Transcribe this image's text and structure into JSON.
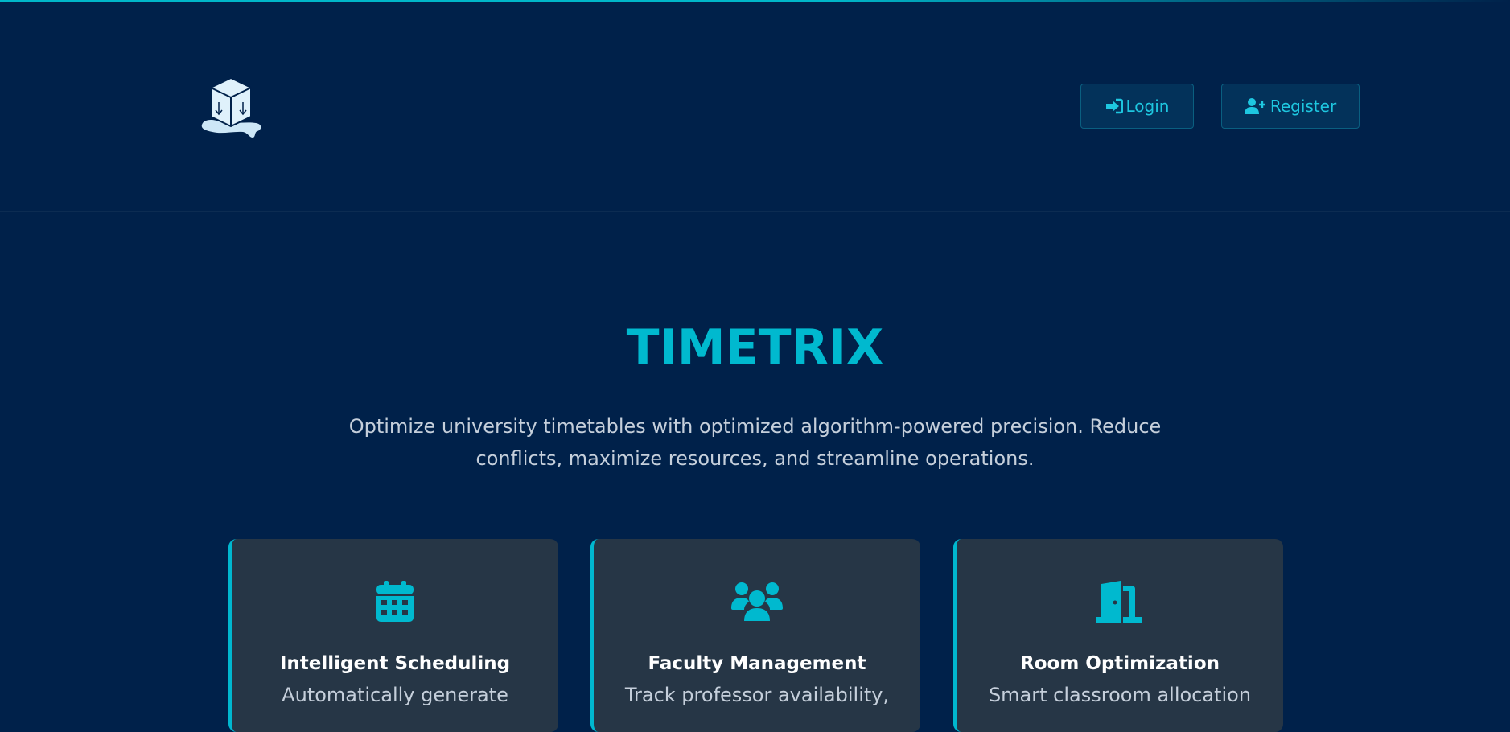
{
  "header": {
    "logo_icon": "ice-cube-logo-icon",
    "login_label": "Login",
    "login_icon": "sign-in-icon",
    "register_label": "Register",
    "register_icon": "user-plus-icon"
  },
  "hero": {
    "title": "TIMETRIX",
    "subtitle": "Optimize university timetables with optimized algorithm-powered precision. Reduce conflicts, maximize resources, and streamline operations."
  },
  "features": [
    {
      "icon": "calendar-icon",
      "title": "Intelligent Scheduling",
      "description": "Automatically generate"
    },
    {
      "icon": "users-icon",
      "title": "Faculty Management",
      "description": "Track professor availability,"
    },
    {
      "icon": "door-open-icon",
      "title": "Room Optimization",
      "description": "Smart classroom allocation"
    }
  ],
  "colors": {
    "background": "#00214a",
    "accent": "#00b9cf",
    "card": "#263646",
    "text_muted": "#c5cfdb"
  }
}
